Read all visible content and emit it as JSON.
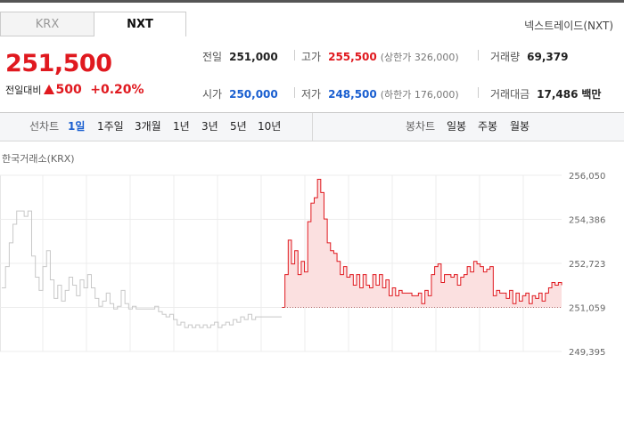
{
  "tabs": {
    "krx": "KRX",
    "nxt": "NXT"
  },
  "venue": "넥스트레이드(NXT)",
  "price": {
    "current": "251,500",
    "change_label": "전일대비",
    "change_value": "500",
    "change_pct": "+0.20%"
  },
  "stats": {
    "prev_close": {
      "label": "전일",
      "value": "251,000"
    },
    "high": {
      "label": "고가",
      "value": "255,500",
      "limit": "(상한가 326,000)"
    },
    "volume": {
      "label": "거래량",
      "value": "69,379"
    },
    "open": {
      "label": "시가",
      "value": "250,000"
    },
    "low": {
      "label": "저가",
      "value": "248,500",
      "limit": "(하한가 176,000)"
    },
    "amount": {
      "label": "거래대금",
      "value": "17,486",
      "unit": "백만"
    }
  },
  "periods": {
    "line_label": "선차트",
    "line": [
      "1일",
      "1주일",
      "3개월",
      "1년",
      "3년",
      "5년",
      "10년"
    ],
    "candle_label": "봉차트",
    "candle": [
      "일봉",
      "주봉",
      "월봉"
    ]
  },
  "chart_label": "한국거래소(KRX)",
  "colors": {
    "up": "#e0191f",
    "down": "#1a5fd0",
    "pre": "#c8c8c8"
  },
  "chart_data": {
    "type": "line",
    "yticks": [
      256050,
      254386,
      252723,
      251059,
      249395
    ],
    "ylim": [
      249395,
      256050
    ],
    "baseline": 251059,
    "series": [
      {
        "values": [
          251800,
          252600,
          253500,
          254200,
          254700,
          254700,
          254500,
          254700,
          253000,
          252200,
          251700,
          252600,
          253200,
          252100,
          251400,
          251900,
          251300,
          251700,
          252200,
          251900,
          251500,
          252100,
          251800,
          252300,
          251800,
          251400,
          251100,
          251300,
          251600,
          251200,
          251000,
          251100,
          251700,
          251200,
          251000,
          251100,
          251000,
          251000,
          251000,
          251000,
          251000,
          251100,
          250900,
          250800,
          250700,
          250800,
          250600,
          250400,
          250500,
          250300,
          250400,
          250300,
          250400,
          250300,
          250400,
          250300,
          250400,
          250500,
          250300,
          250400,
          250500,
          250400,
          250600,
          250500,
          250700,
          250600,
          250800,
          250600,
          250700,
          250700,
          250700,
          250700,
          250700,
          250700,
          250700,
          250700
        ]
      },
      {
        "values": [
          251059,
          252300,
          253600,
          252700,
          253200,
          252300,
          252800,
          252400,
          254300,
          255000,
          255200,
          255900,
          255400,
          254400,
          253500,
          253200,
          253100,
          252800,
          252300,
          252600,
          252200,
          252300,
          251900,
          252300,
          251800,
          252300,
          251900,
          251800,
          252300,
          251900,
          252300,
          251800,
          252100,
          251500,
          251800,
          251500,
          251700,
          251600,
          251600,
          251600,
          251500,
          251500,
          251600,
          251200,
          251700,
          251500,
          252300,
          252600,
          252700,
          252000,
          252300,
          252300,
          252200,
          252300,
          251900,
          252200,
          252300,
          252600,
          252400,
          252800,
          252700,
          252600,
          252400,
          252500,
          252600,
          251500,
          251700,
          251600,
          251600,
          251400,
          251700,
          251200,
          251600,
          251300,
          251500,
          251600,
          251200,
          251500,
          251400,
          251600,
          251300,
          251600,
          251800,
          252000,
          251900,
          252000,
          251900
        ]
      }
    ]
  }
}
